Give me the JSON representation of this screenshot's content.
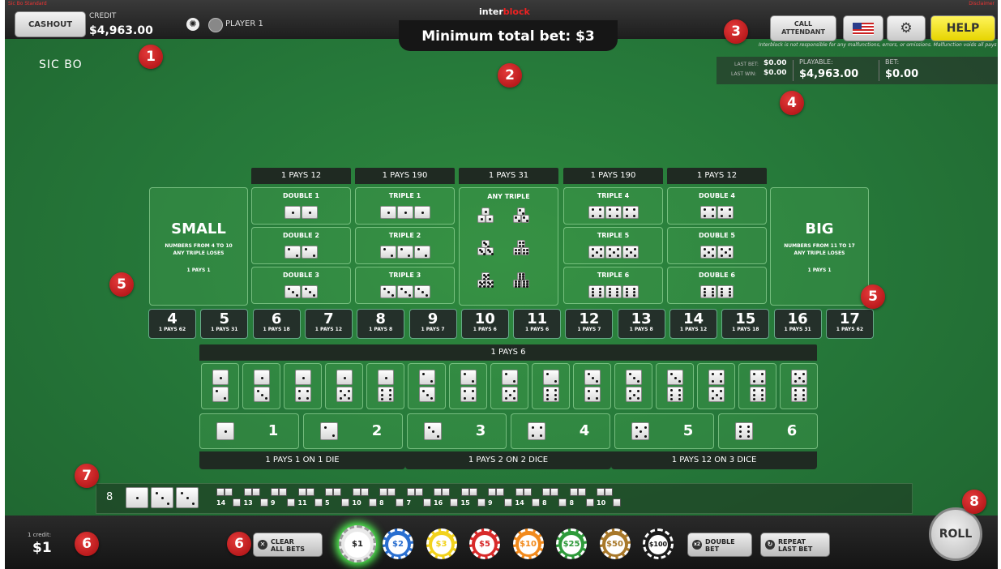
{
  "top_bar": {
    "corner_note_left": "Sic Bo Standard",
    "corner_note_right": "Disclaimer",
    "cashout_label": "CASHOUT",
    "credit_label": "CREDIT",
    "credit_value": "$4,963.00",
    "player_label": "PLAYER 1",
    "logo_prefix": "inter",
    "logo_suffix": "block",
    "min_bet": "Minimum total bet: $3",
    "attendant_label_1": "CALL",
    "attendant_label_2": "ATTENDANT",
    "help_label": "HELP",
    "disclaimer": "Interblock is not responsible for any malfunctions, errors, or omissions. Malfunction voids all pays and plays!"
  },
  "game_title": "SIC BO",
  "stats": {
    "last_bet_label": "LAST BET:",
    "last_bet_value": "$0.00",
    "last_win_label": "LAST WIN:",
    "last_win_value": "$0.00",
    "playable_label": "PLAYABLE:",
    "playable_value": "$4,963.00",
    "bet_label": "BET:",
    "bet_value": "$0.00"
  },
  "table": {
    "small": {
      "title": "SMALL",
      "desc_1": "NUMBERS FROM 4 TO 10",
      "desc_2": "ANY TRIPLE LOSES",
      "pays": "1 PAYS 1"
    },
    "big": {
      "title": "BIG",
      "desc_1": "NUMBERS FROM 11 TO 17",
      "desc_2": "ANY TRIPLE LOSES",
      "pays": "1 PAYS 1"
    },
    "columns": [
      {
        "header": "1 PAYS 12",
        "items": [
          {
            "label": "DOUBLE 1",
            "dice": [
              1,
              1
            ]
          },
          {
            "label": "DOUBLE 2",
            "dice": [
              2,
              2
            ]
          },
          {
            "label": "DOUBLE 3",
            "dice": [
              3,
              3
            ]
          }
        ]
      },
      {
        "header": "1 PAYS 190",
        "items": [
          {
            "label": "TRIPLE 1",
            "dice": [
              1,
              1,
              1
            ]
          },
          {
            "label": "TRIPLE 2",
            "dice": [
              2,
              2,
              2
            ]
          },
          {
            "label": "TRIPLE 3",
            "dice": [
              3,
              3,
              3
            ]
          }
        ]
      },
      {
        "header": "1 PAYS 31",
        "items": [
          {
            "label": "ANY TRIPLE",
            "dice": []
          }
        ]
      },
      {
        "header": "1 PAYS 190",
        "items": [
          {
            "label": "TRIPLE 4",
            "dice": [
              4,
              4,
              4
            ]
          },
          {
            "label": "TRIPLE 5",
            "dice": [
              5,
              5,
              5
            ]
          },
          {
            "label": "TRIPLE 6",
            "dice": [
              6,
              6,
              6
            ]
          }
        ]
      },
      {
        "header": "1 PAYS 12",
        "items": [
          {
            "label": "DOUBLE 4",
            "dice": [
              4,
              4
            ]
          },
          {
            "label": "DOUBLE 5",
            "dice": [
              5,
              5
            ]
          },
          {
            "label": "DOUBLE 6",
            "dice": [
              6,
              6
            ]
          }
        ]
      }
    ],
    "totals": [
      {
        "n": "4",
        "pays": "1 PAYS 62"
      },
      {
        "n": "5",
        "pays": "1 PAYS 31"
      },
      {
        "n": "6",
        "pays": "1 PAYS 18"
      },
      {
        "n": "7",
        "pays": "1 PAYS 12"
      },
      {
        "n": "8",
        "pays": "1 PAYS 8"
      },
      {
        "n": "9",
        "pays": "1 PAYS 7"
      },
      {
        "n": "10",
        "pays": "1 PAYS 6"
      },
      {
        "n": "11",
        "pays": "1 PAYS 6"
      },
      {
        "n": "12",
        "pays": "1 PAYS 7"
      },
      {
        "n": "13",
        "pays": "1 PAYS 8"
      },
      {
        "n": "14",
        "pays": "1 PAYS 12"
      },
      {
        "n": "15",
        "pays": "1 PAYS 18"
      },
      {
        "n": "16",
        "pays": "1 PAYS 31"
      },
      {
        "n": "17",
        "pays": "1 PAYS 62"
      }
    ],
    "combo_header": "1 PAYS 6",
    "combos": [
      [
        1,
        2
      ],
      [
        1,
        3
      ],
      [
        1,
        4
      ],
      [
        1,
        5
      ],
      [
        1,
        6
      ],
      [
        2,
        3
      ],
      [
        2,
        4
      ],
      [
        2,
        5
      ],
      [
        2,
        6
      ],
      [
        3,
        4
      ],
      [
        3,
        5
      ],
      [
        3,
        6
      ],
      [
        4,
        5
      ],
      [
        4,
        6
      ],
      [
        5,
        6
      ]
    ],
    "singles": [
      1,
      2,
      3,
      4,
      5,
      6
    ],
    "single_footer": [
      "1 PAYS 1 ON 1 DIE",
      "1 PAYS 2 ON 2 DICE",
      "1 PAYS 12 ON 3 DICE"
    ]
  },
  "history": {
    "last_total": "8",
    "last_dice": [
      1,
      3,
      3
    ],
    "totals": [
      "14",
      "13",
      "9",
      "11",
      "5",
      "10",
      "8",
      "7",
      "16",
      "15",
      "9",
      "14",
      "8",
      "8",
      "10"
    ]
  },
  "bottom": {
    "credit_label": "1 credit:",
    "credit_value": "$1",
    "clear_1": "CLEAR",
    "clear_2": "ALL BETS",
    "chips": [
      {
        "label": "$1",
        "color": "#e9e9e9",
        "text": "#222",
        "selected": true
      },
      {
        "label": "$2",
        "color": "#2a6fd0",
        "text": "#fff"
      },
      {
        "label": "$3",
        "color": "#f2d21c",
        "text": "#222"
      },
      {
        "label": "$5",
        "color": "#d82a2a",
        "text": "#fff"
      },
      {
        "label": "$10",
        "color": "#f28a1c",
        "text": "#fff"
      },
      {
        "label": "$25",
        "color": "#2e9a3a",
        "text": "#fff"
      },
      {
        "label": "$50",
        "color": "#a8782a",
        "text": "#fff"
      },
      {
        "label": "$100",
        "color": "#1c1c1c",
        "text": "#fff"
      }
    ],
    "double_1": "DOUBLE",
    "double_2": "BET",
    "double_icon": "x2",
    "repeat_1": "REPEAT",
    "repeat_2": "LAST BET",
    "roll_label": "ROLL"
  },
  "badges": [
    "1",
    "2",
    "3",
    "4",
    "5",
    "5",
    "6",
    "6",
    "7",
    "8"
  ],
  "colors": {
    "felt": "#26793a",
    "badge": "#c0171a",
    "help": "#f5e61c"
  }
}
